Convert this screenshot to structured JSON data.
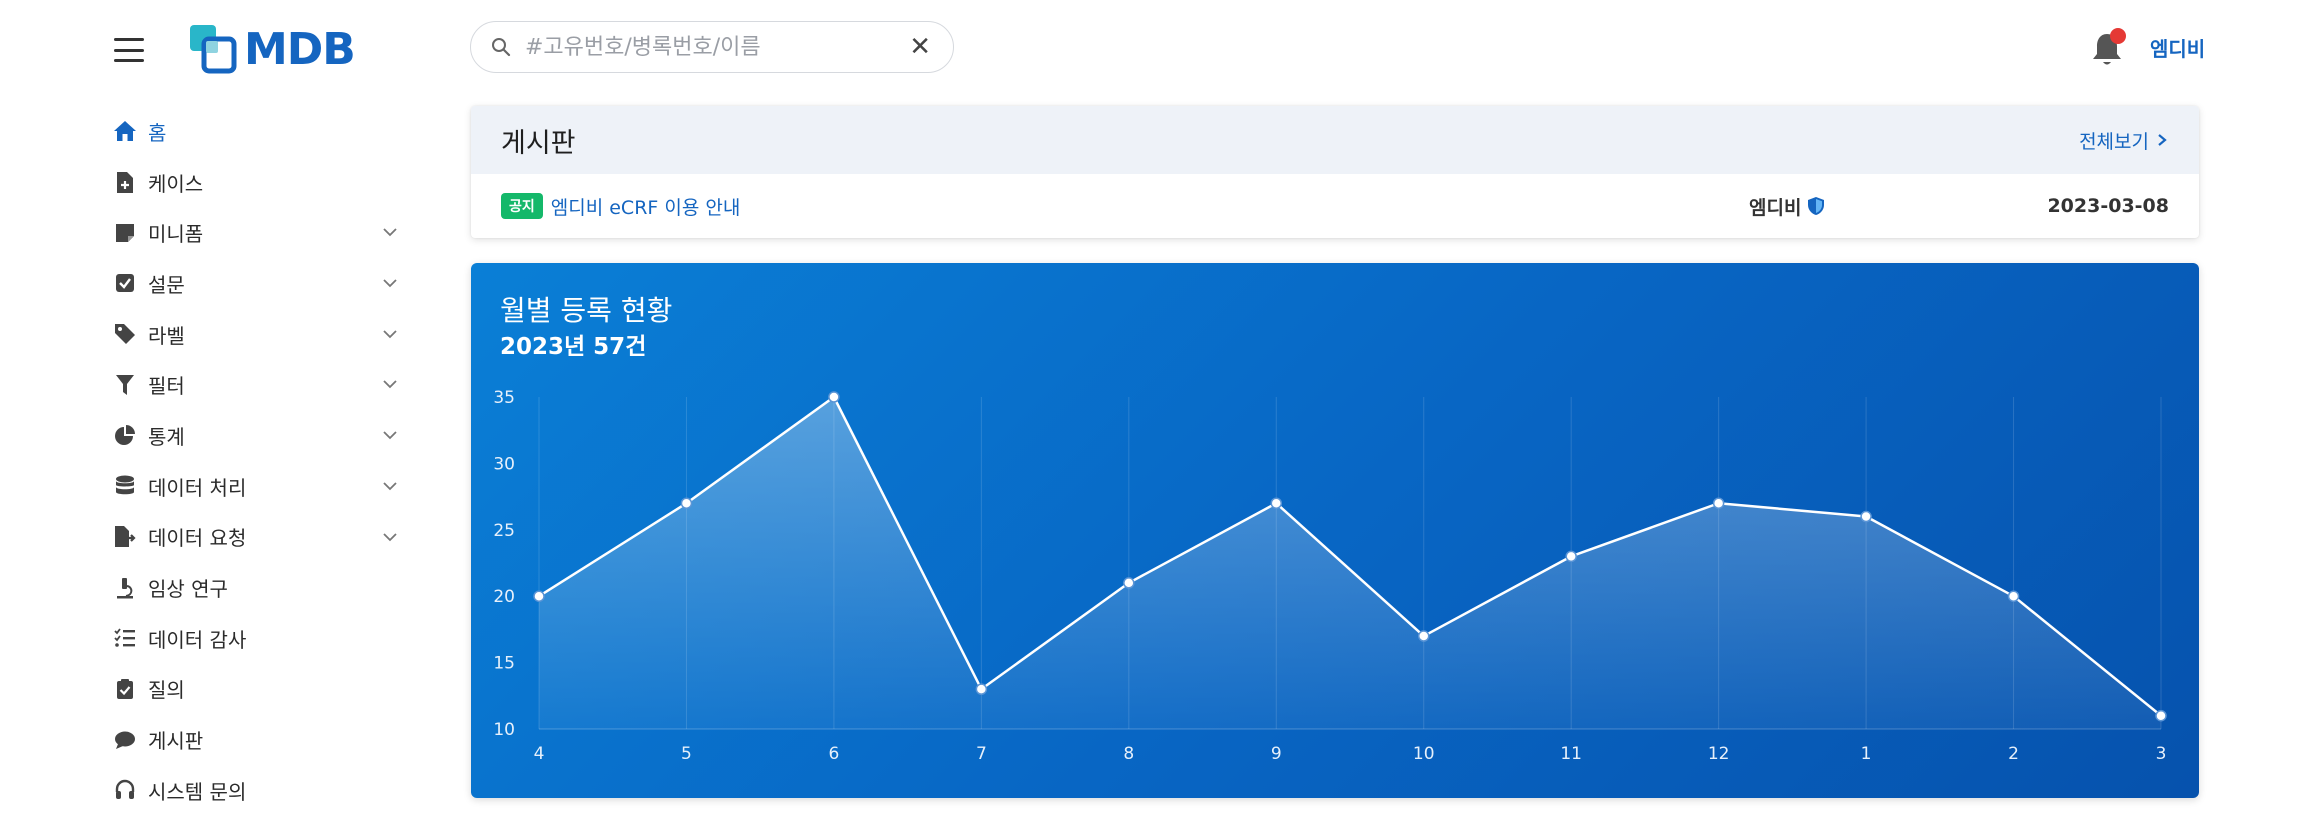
{
  "header": {
    "logo_text": "MDB",
    "search_placeholder": "#고유번호/병록번호/이름",
    "user_name": "엠디비",
    "accent_color": "#1565c0",
    "notification_dot_color": "#e53935"
  },
  "sidebar": {
    "items": [
      {
        "label": "홈",
        "icon": "home-icon",
        "expandable": false,
        "active": true
      },
      {
        "label": "케이스",
        "icon": "file-plus-icon",
        "expandable": false
      },
      {
        "label": "미니폼",
        "icon": "note-icon",
        "expandable": true
      },
      {
        "label": "설문",
        "icon": "checkbox-icon",
        "expandable": true
      },
      {
        "label": "라벨",
        "icon": "tag-icon",
        "expandable": true
      },
      {
        "label": "필터",
        "icon": "filter-icon",
        "expandable": true
      },
      {
        "label": "통계",
        "icon": "pie-chart-icon",
        "expandable": true
      },
      {
        "label": "데이터 처리",
        "icon": "database-icon",
        "expandable": true
      },
      {
        "label": "데이터 요청",
        "icon": "file-export-icon",
        "expandable": true
      },
      {
        "label": "임상 연구",
        "icon": "microscope-icon",
        "expandable": false
      },
      {
        "label": "데이터 감사",
        "icon": "list-check-icon",
        "expandable": false
      },
      {
        "label": "질의",
        "icon": "clipboard-check-icon",
        "expandable": false
      },
      {
        "label": "게시판",
        "icon": "comment-icon",
        "expandable": false
      },
      {
        "label": "시스템 문의",
        "icon": "headset-icon",
        "expandable": false
      }
    ]
  },
  "board": {
    "title": "게시판",
    "more_label": "전체보기",
    "posts": [
      {
        "badge": "공지",
        "title": "엠디비 eCRF 이용 안내",
        "author": "엠디비",
        "date": "2023-03-08"
      }
    ]
  },
  "chart": {
    "title": "월별 등록 현황",
    "subtitle": "2023년 57건"
  },
  "chart_data": {
    "type": "area",
    "title": "월별 등록 현황",
    "subtitle": "2023년 57건",
    "categories": [
      "4",
      "5",
      "6",
      "7",
      "8",
      "9",
      "10",
      "11",
      "12",
      "1",
      "2",
      "3"
    ],
    "values": [
      20,
      27,
      35,
      13,
      21,
      27,
      17,
      23,
      27,
      26,
      20,
      11
    ],
    "ylim": [
      10,
      35
    ],
    "yticks": [
      10,
      15,
      20,
      25,
      30,
      35
    ],
    "grid": "vertical",
    "line_color": "#ffffff",
    "background_color": "#0a72cf"
  }
}
